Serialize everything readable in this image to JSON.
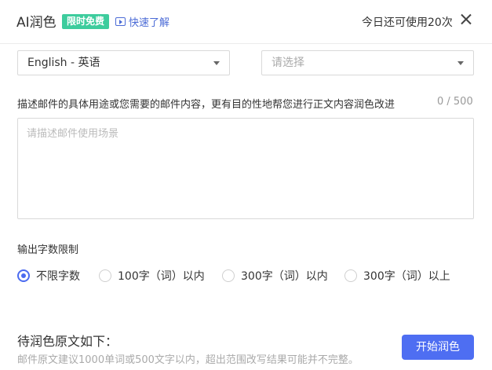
{
  "header": {
    "title": "AI润色",
    "badge": "限时免费",
    "quick_link": "快速了解",
    "remaining": "今日还可使用20次"
  },
  "selects": {
    "language": "English - 英语",
    "scene_placeholder": "请选择"
  },
  "description": {
    "label": "描述邮件的具体用途或您需要的邮件内容，更有目的性地帮您进行正文内容润色改进",
    "counter": "0 / 500",
    "placeholder": "请描述邮件使用场景"
  },
  "word_limit": {
    "label": "输出字数限制",
    "options": [
      "不限字数",
      "100字（词）以内",
      "300字（词）以内",
      "300字（词）以上"
    ],
    "selected": "不限字数"
  },
  "original": {
    "title": "待润色原文如下：",
    "tip": "邮件原文建议1000单词或500文字以内，超出范围改写结果可能并不完整。"
  },
  "actions": {
    "start": "开始润色"
  },
  "colors": {
    "accent": "#4e6ef2",
    "badge": "#3dcc9d",
    "link": "#4b6bd6"
  }
}
